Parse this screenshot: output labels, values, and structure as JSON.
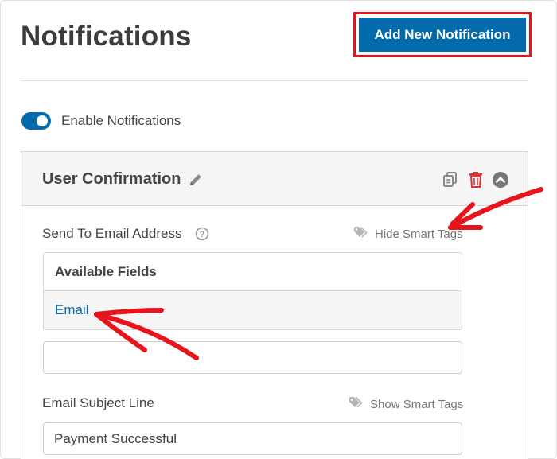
{
  "page": {
    "title": "Notifications",
    "add_button_label": "Add New Notification"
  },
  "toggle": {
    "label": "Enable Notifications",
    "enabled": true
  },
  "notification": {
    "title": "User Confirmation",
    "send_to": {
      "label": "Send To Email Address",
      "smart_tags_label": "Hide Smart Tags",
      "available_fields_heading": "Available Fields",
      "available_fields": [
        "Email"
      ],
      "value": ""
    },
    "subject": {
      "label": "Email Subject Line",
      "smart_tags_label": "Show Smart Tags",
      "value": "Payment Successful"
    }
  },
  "colors": {
    "accent": "#036aab",
    "highlight": "#e8141c",
    "delete": "#d63638"
  },
  "icons": {
    "edit": "pencil-icon",
    "help": "question-circle-icon",
    "smart_tags": "tag-icon",
    "duplicate": "copy-icon",
    "delete": "trash-icon",
    "collapse": "chevron-up-circle-icon"
  }
}
